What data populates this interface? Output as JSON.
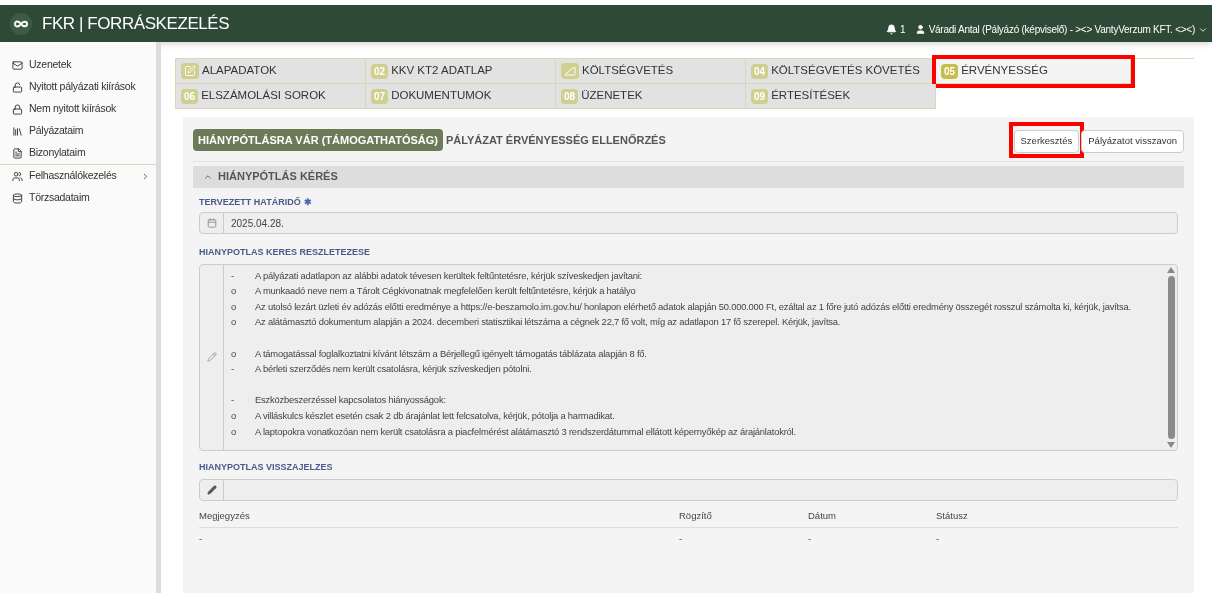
{
  "header": {
    "title": "FKR | FORRÁSKEZELÉS",
    "notification_count": "1",
    "user": "Váradi Antal (Pályázó (képviselő) - ><> VantyVerzum KFT. <><)"
  },
  "sidebar": {
    "groups": [
      [
        {
          "label": "Uzenetek",
          "has_submenu": false
        },
        {
          "label": "Nyitott pályázati kiírások",
          "has_submenu": false
        },
        {
          "label": "Nem nyitott kiírások",
          "has_submenu": false
        },
        {
          "label": "Pályázataim",
          "has_submenu": false
        },
        {
          "label": "Bizonylataim",
          "has_submenu": false
        }
      ],
      [
        {
          "label": "Felhasználókezelés",
          "has_submenu": true
        },
        {
          "label": "Törzsadataim",
          "has_submenu": false
        }
      ]
    ]
  },
  "tabs": [
    {
      "label": "ALAPADATOK",
      "kind": "icon",
      "selected": false,
      "highlighted": false
    },
    {
      "label": "KKV KT2 ADATLAP",
      "kind": "number",
      "number": "02",
      "selected": false,
      "highlighted": false
    },
    {
      "label": "KÖLTSÉGVETÉS",
      "kind": "icon",
      "selected": false,
      "highlighted": false
    },
    {
      "label": "KÖLTSÉGVETÉS KÖVETÉS",
      "kind": "number",
      "number": "04",
      "selected": false,
      "highlighted": false
    },
    {
      "label": "ÉRVÉNYESSÉG",
      "kind": "number",
      "number": "05",
      "selected": true,
      "highlighted": true
    },
    {
      "label": "ELSZÁMOLÁSI SOROK",
      "kind": "number",
      "number": "06",
      "selected": false,
      "highlighted": false
    },
    {
      "label": "DOKUMENTUMOK",
      "kind": "number",
      "number": "07",
      "selected": false,
      "highlighted": false
    },
    {
      "label": "ÜZENETEK",
      "kind": "number",
      "number": "08",
      "selected": false,
      "highlighted": false
    },
    {
      "label": "ÉRTESÍTÉSEK",
      "kind": "number",
      "number": "09",
      "selected": false,
      "highlighted": false
    }
  ],
  "panel": {
    "status_badge": "HIÁNYPÓTLÁSRA VÁR (TÁMOGATHATÓSÁG)",
    "title": "PÁLYÁZAT ÉRVÉNYESSÉG ELLENŐRZÉS",
    "buttons": [
      {
        "label": "Szerkesztés",
        "highlighted": true
      },
      {
        "label": "Pályázatot visszavon",
        "highlighted": false
      }
    ],
    "section": {
      "title": "HIÁNYPÓTLÁS KÉRÉS",
      "expanded": true
    },
    "deadline": {
      "label": "TERVEZETT HATÁRIDŐ",
      "required_mark": "✱",
      "value": "2025.04.28."
    },
    "details": {
      "label": "HIANYPOTLAS KERES RESZLETEZESE",
      "lines": [
        {
          "kind": "item",
          "marker": "-",
          "text": "A pályázati adatlapon az alábbi adatok tévesen kerültek feltűntetésre, kérjük szíveskedjen javítani:"
        },
        {
          "kind": "item",
          "marker": "o",
          "text": "A munkaadó neve nem a Tárolt Cégkivonatnak megfelelően került feltűntetésre, kérjük a hatályo"
        },
        {
          "kind": "item",
          "marker": "o",
          "text": "Az utolsó lezárt üzleti év adózás előtti eredménye a https://e-beszamolo.im.gov.hu/ honlapon elérhető adatok alapján 50.000.000 Ft, ezáltal az 1 főre jutó adózás előtti eredmény összegét rosszul számolta ki, kérjük, javítsa."
        },
        {
          "kind": "item",
          "marker": "o",
          "text": "Az alátámasztó dokumentum alapján a 2024. decemberi statisztikai létszáma a cégnek 22,7 fő volt, míg az adatlapon 17 fő szerepel. Kérjük, javítsa."
        },
        {
          "kind": "blank"
        },
        {
          "kind": "item",
          "marker": "o",
          "text": "A támogatással foglalkoztatni kívánt létszám a Bérjellegű igényelt támogatás táblázata alapján 8 fő."
        },
        {
          "kind": "item",
          "marker": "-",
          "text": "A bérleti szerződés nem került csatolásra, kérjük szíveskedjen pótolni."
        },
        {
          "kind": "blank"
        },
        {
          "kind": "item",
          "marker": "-",
          "text": "Eszközbeszerzéssel kapcsolatos hiányosságok:"
        },
        {
          "kind": "item",
          "marker": "o",
          "text": "A villáskulcs készlet esetén csak 2 db árajánlat lett felcsatolva, kérjük, pótolja a harmadikat."
        },
        {
          "kind": "item",
          "marker": "o",
          "text": "A laptopokra vonatkozóan nem került csatolásra a piacfelmérést alátámasztó 3 rendszerdátummal ellátott képernyőkép az árajánlatokról."
        }
      ]
    },
    "feedback": {
      "label": "HIANYPOTLAS VISSZAJELZES"
    },
    "table": {
      "columns": [
        "Megjegyzés",
        "Rögzítő",
        "Dátum",
        "Státusz"
      ],
      "rows": [
        [
          "-",
          "-",
          "-",
          "-"
        ]
      ]
    }
  }
}
